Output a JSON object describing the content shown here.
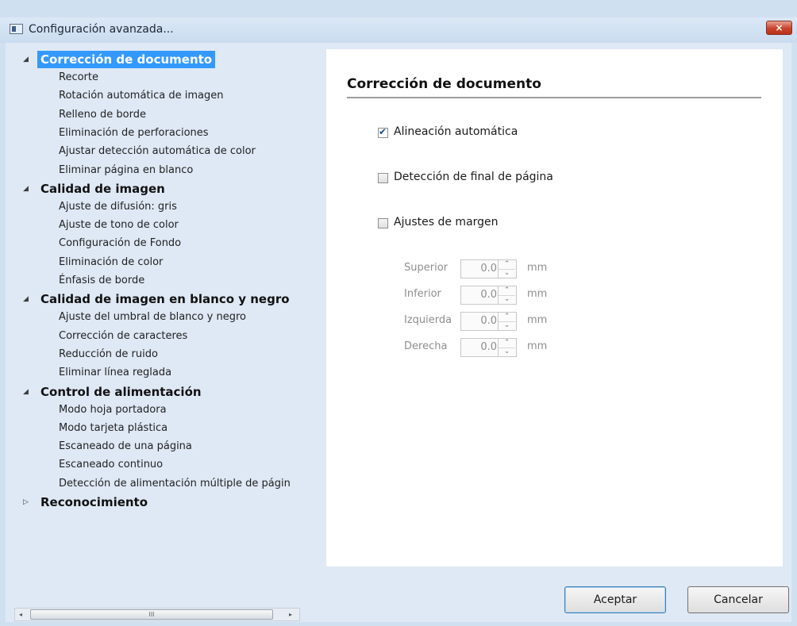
{
  "window": {
    "title": "Configuración avanzada...",
    "close_label": "×"
  },
  "tree": [
    {
      "label": "Corrección de documento",
      "expanded": true,
      "selected": true,
      "children": [
        "Recorte",
        "Rotación automática de imagen",
        "Relleno de borde",
        "Eliminación de perforaciones",
        "Ajustar detección automática de color",
        "Eliminar página en blanco"
      ]
    },
    {
      "label": "Calidad de imagen",
      "expanded": true,
      "selected": false,
      "children": [
        "Ajuste de difusión: gris",
        "Ajuste de tono de color",
        "Configuración de Fondo",
        "Eliminación de color",
        "Énfasis de borde"
      ]
    },
    {
      "label": "Calidad de imagen en blanco y negro",
      "expanded": true,
      "selected": false,
      "children": [
        "Ajuste del umbral de blanco y negro",
        "Corrección de caracteres",
        "Reducción de ruido",
        "Eliminar línea reglada"
      ]
    },
    {
      "label": "Control de alimentación",
      "expanded": true,
      "selected": false,
      "children": [
        "Modo hoja portadora",
        "Modo tarjeta plástica",
        "Escaneado de una página",
        "Escaneado continuo",
        "Detección de alimentación múltiple de págin"
      ]
    },
    {
      "label": "Reconocimiento",
      "expanded": false,
      "selected": false,
      "children": []
    }
  ],
  "scrollbar": {
    "left_arrow": "◂",
    "right_arrow": "▸",
    "thumb_grip": "III"
  },
  "panel": {
    "title": "Corrección de documento",
    "options": [
      {
        "label": "Alineación automática",
        "checked": true
      },
      {
        "label": "Detección de final de página",
        "checked": false
      },
      {
        "label": "Ajustes de margen",
        "checked": false
      }
    ],
    "margins": [
      {
        "label": "Superior",
        "value": "0.0",
        "unit": "mm"
      },
      {
        "label": "Inferior",
        "value": "0.0",
        "unit": "mm"
      },
      {
        "label": "Izquierda",
        "value": "0.0",
        "unit": "mm"
      },
      {
        "label": "Derecha",
        "value": "0.0",
        "unit": "mm"
      }
    ],
    "spin_up": "⌃",
    "spin_down": "⌄"
  },
  "buttons": {
    "ok": "Aceptar",
    "cancel": "Cancelar"
  },
  "colors": {
    "selection": "#3399ff",
    "window_frame": "#cfe0f1",
    "close": "#c8432c"
  }
}
